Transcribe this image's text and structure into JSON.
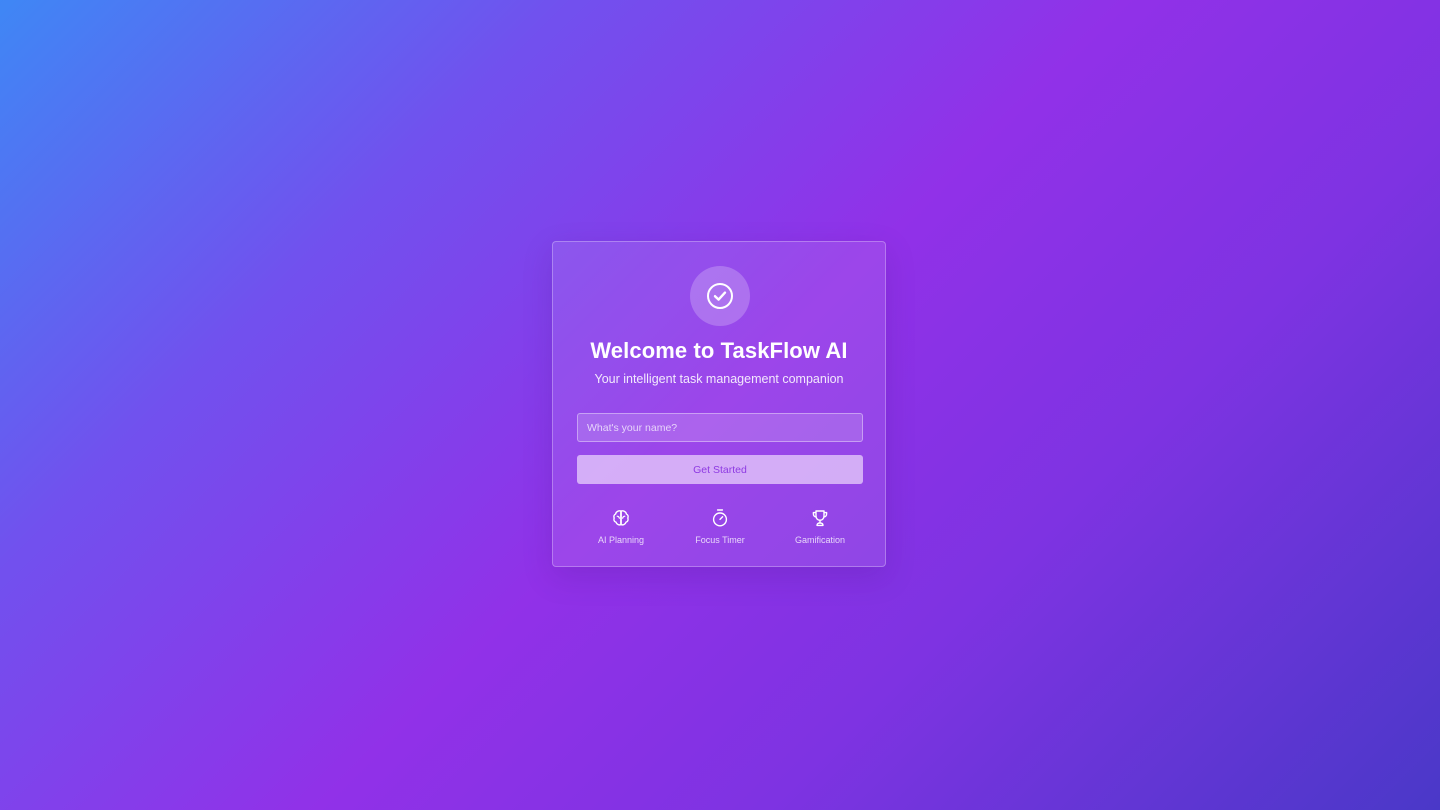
{
  "welcome": {
    "title": "Welcome to TaskFlow AI",
    "subtitle": "Your intelligent task management companion",
    "logo_icon": "check-circle-icon"
  },
  "form": {
    "name_placeholder": "What's your name?",
    "name_value": "",
    "submit_label": "Get Started"
  },
  "features": [
    {
      "label": "AI Planning",
      "icon": "brain-icon"
    },
    {
      "label": "Focus Timer",
      "icon": "stopwatch-icon"
    },
    {
      "label": "Gamification",
      "icon": "trophy-icon"
    }
  ],
  "colors": {
    "gradient_start": "#3f87f5",
    "gradient_mid": "#9131e8",
    "gradient_end": "#4a38c8",
    "button_text": "#8e3be2"
  }
}
